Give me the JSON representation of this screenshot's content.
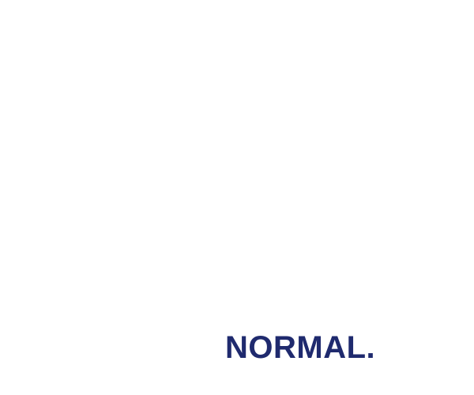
{
  "wordmark": {
    "text": "NORMAL.",
    "color": "#1f2a6e"
  },
  "background_color": "#ffffff"
}
